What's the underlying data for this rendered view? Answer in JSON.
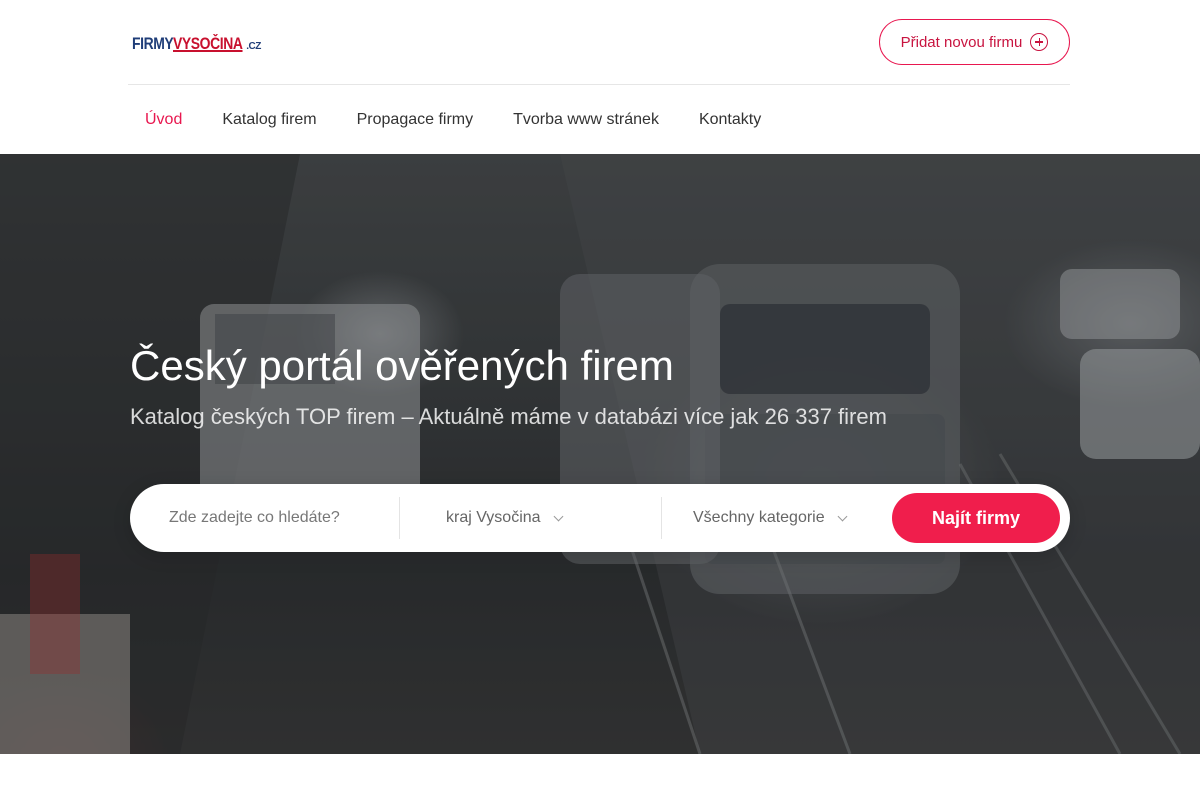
{
  "logo": {
    "part1": "FIRMY",
    "part2": "VYSOČINA",
    "part3": ".CZ"
  },
  "header": {
    "add_company_label": "Přidat novou firmu"
  },
  "nav": {
    "items": [
      {
        "label": "Úvod",
        "active": true
      },
      {
        "label": "Katalog firem",
        "active": false
      },
      {
        "label": "Propagace firmy",
        "active": false
      },
      {
        "label": "Tvorba www stránek",
        "active": false
      },
      {
        "label": "Kontakty",
        "active": false
      }
    ]
  },
  "hero": {
    "title": "Český portál ověřených firem",
    "subtitle": "Katalog českých TOP firem – Aktuálně máme v databázi více jak 26 337 firem"
  },
  "search": {
    "placeholder": "Zde zadejte co hledáte?",
    "region_value": "kraj Vysočina",
    "category_value": "Všechny kategorie",
    "submit_label": "Najít firmy"
  },
  "colors": {
    "accent": "#e8174f",
    "button": "#f01e4c",
    "logo_blue": "#1f3d78",
    "logo_red": "#c8102e"
  }
}
